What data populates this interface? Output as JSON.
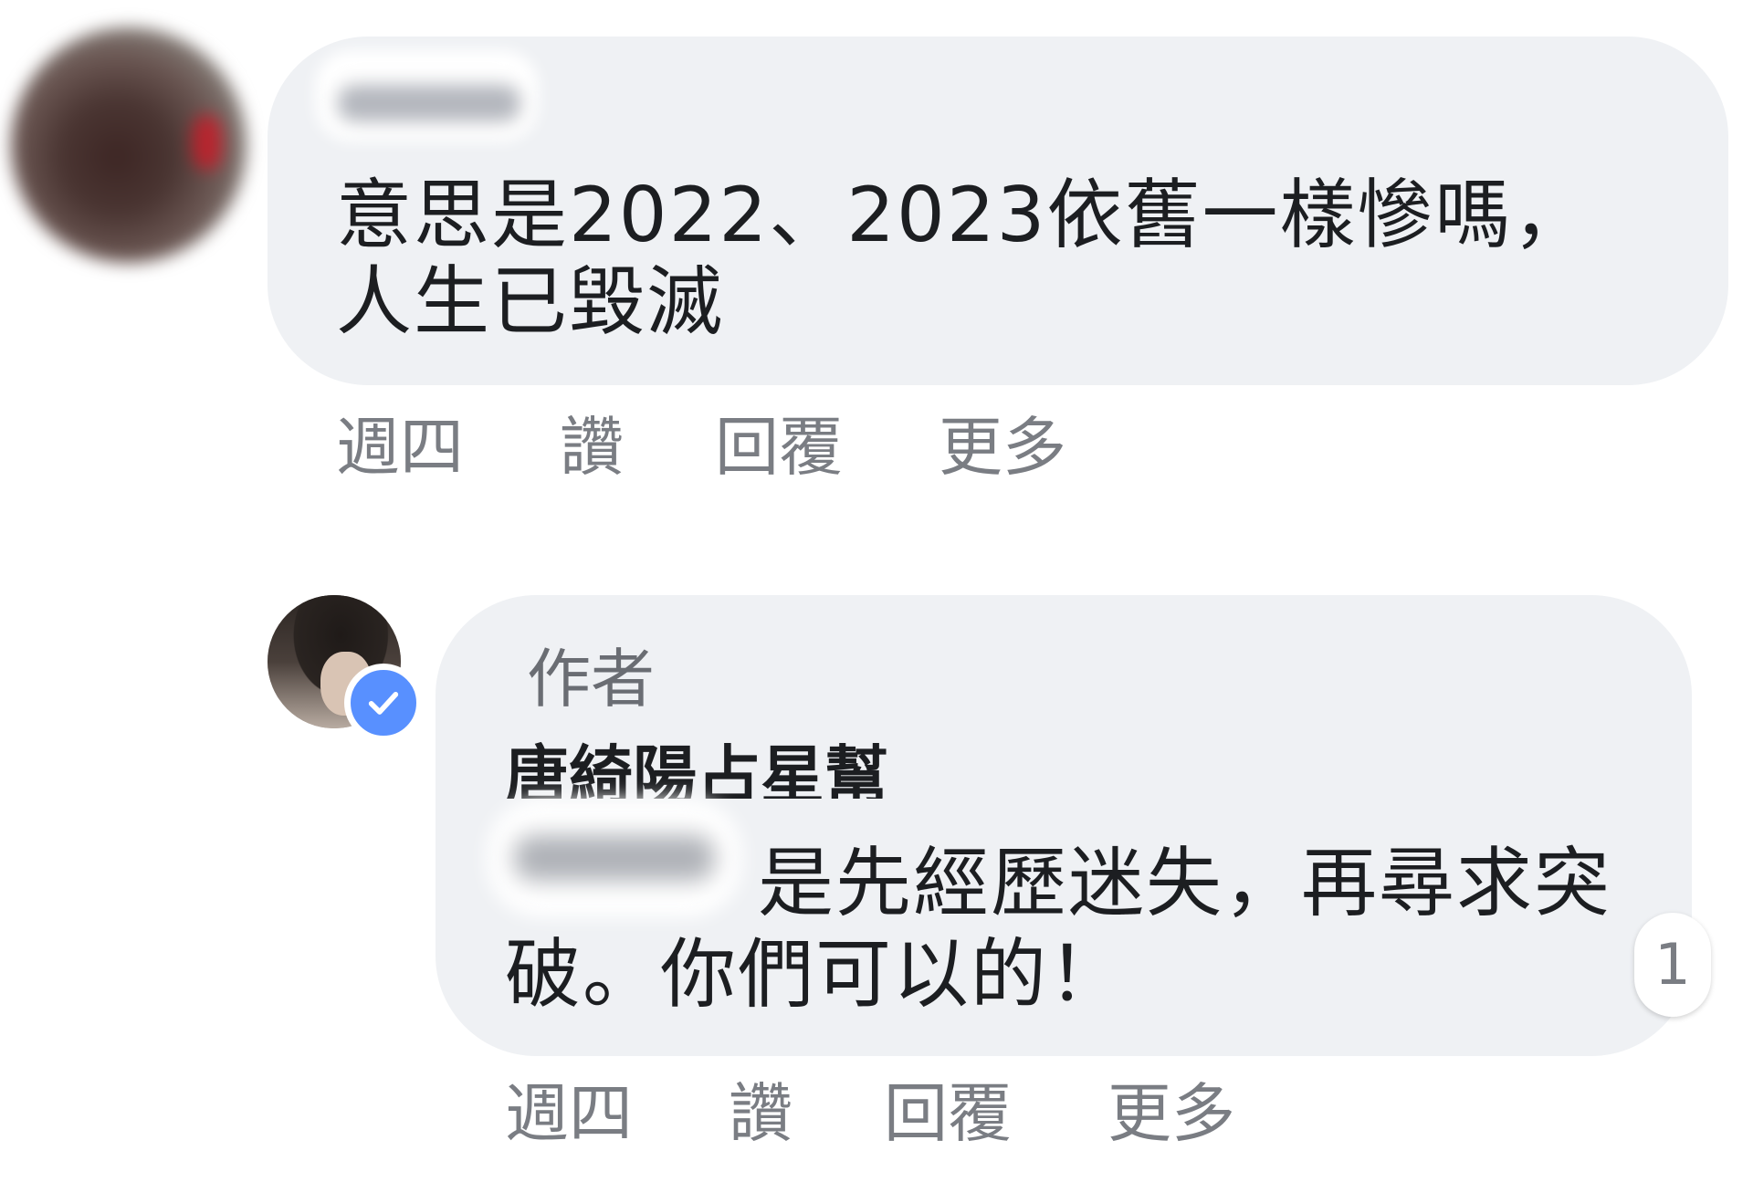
{
  "comments": [
    {
      "text": "意思是2022、2023依舊一樣慘嗎，人生已毀滅",
      "actions": {
        "time": "週四",
        "like": "讚",
        "reply": "回覆",
        "more": "更多"
      }
    }
  ],
  "reply": {
    "author_tag": "作者",
    "author_name": "唐綺陽占星幫",
    "text": "是先經歷迷失，再尋求突破。你們可以的！",
    "reaction_count": "1",
    "verified": true,
    "actions": {
      "time": "週四",
      "like": "讚",
      "reply": "回覆",
      "more": "更多"
    }
  },
  "icons": [
    "avatar",
    "verified-check-icon"
  ],
  "colors": {
    "bubble": "#eff1f4",
    "verified": "#5890ff",
    "meta_text": "#7a7d83"
  }
}
